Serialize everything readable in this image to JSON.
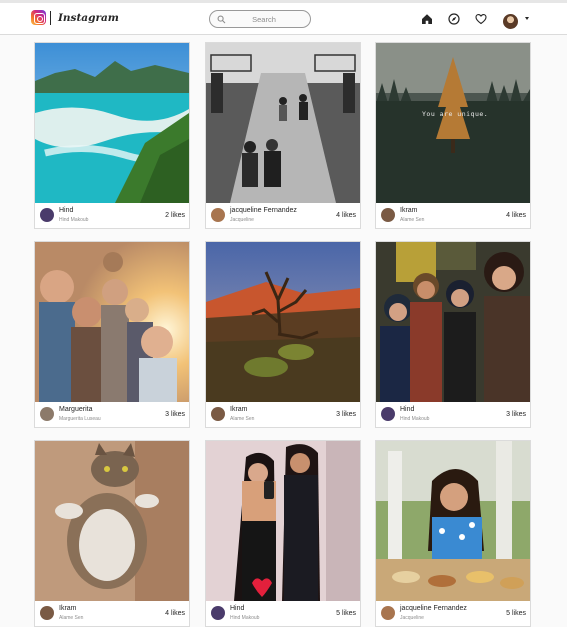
{
  "header": {
    "brand": "Instagram",
    "search_placeholder": "Search",
    "icons": [
      "home-icon",
      "explore-icon",
      "heart-icon",
      "profile-avatar",
      "chevron-down-icon"
    ]
  },
  "posts": [
    {
      "name": "Hind",
      "username": "Hind Makoub",
      "likes": "2 likes",
      "image": "tropical-beach-lagoon"
    },
    {
      "name": "jacqueline Fernandez",
      "username": "Jacqueline",
      "likes": "4 likes",
      "image": "black-white-bridge-couples"
    },
    {
      "name": "Ikram",
      "username": "Alame Sen",
      "likes": "4 likes",
      "image": "misty-forest-you-are-unique",
      "overlay_text": "You are unique."
    },
    {
      "name": "Marguerita",
      "username": "Marguerita Luseau",
      "likes": "3 likes",
      "image": "group-selfie-sunlight"
    },
    {
      "name": "Ikram",
      "username": "Alame Sen",
      "likes": "3 likes",
      "image": "desert-dead-tree-sunset"
    },
    {
      "name": "Hind",
      "username": "Hind Makoub",
      "likes": "3 likes",
      "image": "friends-group-photo"
    },
    {
      "name": "Ikram",
      "username": "Alame Sen",
      "likes": "4 likes",
      "image": "tabby-cat-lying-on-back"
    },
    {
      "name": "Hind",
      "username": "Hind Makoub",
      "likes": "5 likes",
      "image": "mirror-selfie-two-girls"
    },
    {
      "name": "jacqueline Fernandez",
      "username": "Jacqueline",
      "likes": "5 likes",
      "image": "woman-at-dining-table"
    }
  ]
}
